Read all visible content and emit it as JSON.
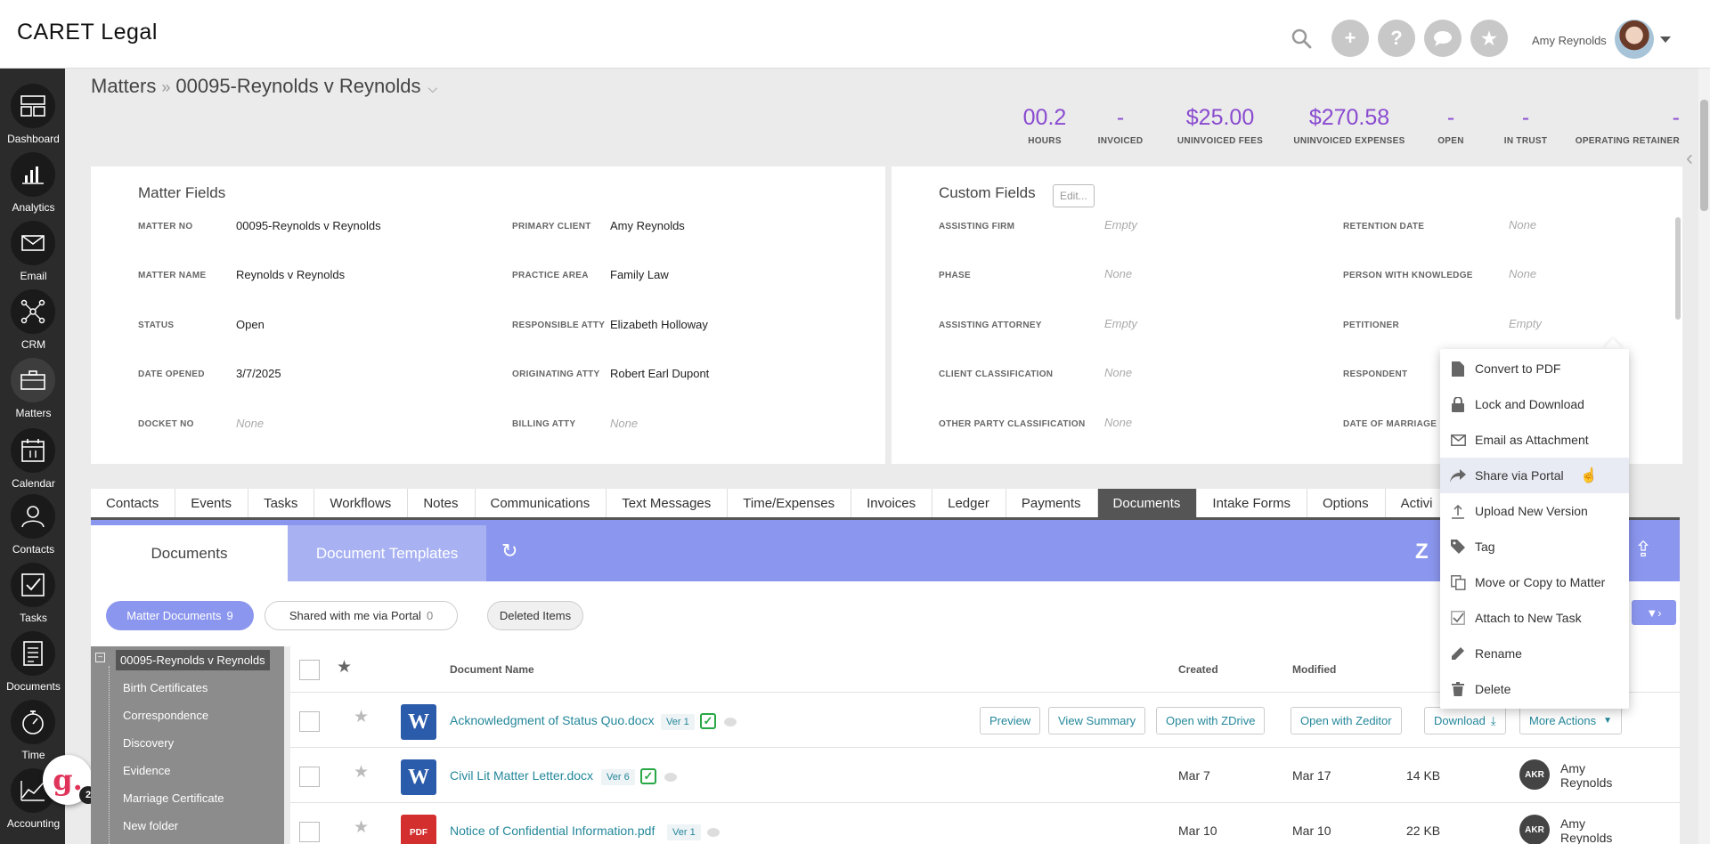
{
  "app": {
    "logo_text": "CARET Legal",
    "user_name": "Amy Reynolds"
  },
  "leftnav": [
    {
      "label": "Dashboard",
      "icon": "dashboard-icon"
    },
    {
      "label": "Analytics",
      "icon": "analytics-icon"
    },
    {
      "label": "Email",
      "icon": "email-icon"
    },
    {
      "label": "CRM",
      "icon": "crm-icon"
    },
    {
      "label": "Matters",
      "icon": "briefcase-icon"
    },
    {
      "label": "Calendar",
      "icon": "calendar-icon"
    },
    {
      "label": "Contacts",
      "icon": "contacts-icon"
    },
    {
      "label": "Tasks",
      "icon": "tasks-icon"
    },
    {
      "label": "Documents",
      "icon": "documents-icon"
    },
    {
      "label": "Time",
      "icon": "stopwatch-icon"
    },
    {
      "label": "Accounting",
      "icon": "accounting-icon"
    }
  ],
  "notification": {
    "letter": "g.",
    "count": "2"
  },
  "breadcrumb": {
    "root": "Matters",
    "separator": "»",
    "current": "00095-Reynolds v Reynolds"
  },
  "stats": [
    {
      "value": "00.2",
      "label": "HOURS"
    },
    {
      "value": "-",
      "label": "INVOICED"
    },
    {
      "value": "$25.00",
      "label": "UNINVOICED FEES"
    },
    {
      "value": "$270.58",
      "label": "UNINVOICED EXPENSES"
    },
    {
      "value": "-",
      "label": "OPEN"
    },
    {
      "value": "-",
      "label": "IN TRUST"
    },
    {
      "value": "-",
      "label": "OPERATING RETAINER"
    }
  ],
  "matter_fields": {
    "title": "Matter Fields",
    "fields": [
      {
        "label": "MATTER NO",
        "value": "00095-Reynolds v Reynolds"
      },
      {
        "label": "PRIMARY CLIENT",
        "value": "Amy Reynolds"
      },
      {
        "label": "MATTER NAME",
        "value": "Reynolds v Reynolds"
      },
      {
        "label": "PRACTICE AREA",
        "value": "Family Law"
      },
      {
        "label": "STATUS",
        "value": "Open"
      },
      {
        "label": "RESPONSIBLE ATTY",
        "value": "Elizabeth Holloway"
      },
      {
        "label": "DATE OPENED",
        "value": "3/7/2025"
      },
      {
        "label": "ORIGINATING ATTY",
        "value": "Robert Earl Dupont"
      },
      {
        "label": "DOCKET NO",
        "value": "None"
      },
      {
        "label": "BILLING ATTY",
        "value": "None"
      }
    ]
  },
  "custom_fields": {
    "title": "Custom Fields",
    "edit_label": "Edit...",
    "fields": [
      {
        "label": "ASSISTING FIRM",
        "value": "Empty"
      },
      {
        "label": "RETENTION DATE",
        "value": "None"
      },
      {
        "label": "PHASE",
        "value": "None"
      },
      {
        "label": "PERSON WITH KNOWLEDGE",
        "value": "None"
      },
      {
        "label": "ASSISTING ATTORNEY",
        "value": "Empty"
      },
      {
        "label": "PETITIONER",
        "value": "Empty"
      },
      {
        "label": "CLIENT CLASSIFICATION",
        "value": "None"
      },
      {
        "label": "RESPONDENT",
        "value": ""
      },
      {
        "label": "OTHER PARTY CLASSIFICATION",
        "value": "None"
      },
      {
        "label": "DATE OF MARRIAGE",
        "value": ""
      }
    ]
  },
  "tabs": [
    "Contacts",
    "Events",
    "Tasks",
    "Workflows",
    "Notes",
    "Communications",
    "Text Messages",
    "Time/Expenses",
    "Invoices",
    "Ledger",
    "Payments",
    "Documents",
    "Intake Forms",
    "Options",
    "Activi"
  ],
  "active_tab": "Documents",
  "documents": {
    "tab_documents": "Documents",
    "tab_templates": "Document Templates",
    "filters": [
      {
        "label": "Matter Documents",
        "count": "9"
      },
      {
        "label": "Shared with me via Portal",
        "count": "0"
      },
      {
        "label": "Deleted Items",
        "count": ""
      }
    ],
    "filter_button": "▼›"
  },
  "tree": {
    "root": "00095-Reynolds v Reynolds",
    "toggle": "−",
    "folders": [
      "Birth Certificates",
      "Correspondence",
      "Discovery",
      "Evidence",
      "Marriage Certificate",
      "New folder"
    ]
  },
  "table": {
    "headers": {
      "name": "Document Name",
      "created": "Created",
      "modified": "Modified"
    },
    "rows": [
      {
        "name": "Acknowledgment of Status Quo.docx",
        "ver": "Ver 1",
        "type": "word",
        "created": "",
        "modified": "",
        "size": ""
      },
      {
        "name": "Civil Lit Matter Letter.docx",
        "ver": "Ver 6",
        "type": "word",
        "created": "Mar 7",
        "modified": "Mar 17",
        "size": "14 KB",
        "owner_initials": "AKR",
        "owner": "Amy Reynolds"
      },
      {
        "name": "Notice of Confidential Information.pdf",
        "ver": "Ver 1",
        "type": "pdf",
        "created": "Mar 10",
        "modified": "Mar 10",
        "size": "22 KB",
        "owner_initials": "AKR",
        "owner": "Amy Reynolds"
      }
    ],
    "row_actions": [
      "Preview",
      "View Summary",
      "Open with ZDrive",
      "Open with Zeditor",
      "Download",
      "More Actions"
    ]
  },
  "context_menu": [
    {
      "label": "Convert to PDF",
      "icon": "file-icon"
    },
    {
      "label": "Lock and Download",
      "icon": "lock-icon"
    },
    {
      "label": "Email as Attachment",
      "icon": "envelope-icon"
    },
    {
      "label": "Share via Portal",
      "icon": "share-icon"
    },
    {
      "label": "Upload New Version",
      "icon": "upload-icon"
    },
    {
      "label": "Tag",
      "icon": "tag-icon"
    },
    {
      "label": "Move or Copy to Matter",
      "icon": "copy-icon"
    },
    {
      "label": "Attach to New Task",
      "icon": "task-check-icon"
    },
    {
      "label": "Rename",
      "icon": "pencil-icon"
    },
    {
      "label": "Delete",
      "icon": "trash-icon"
    }
  ],
  "colors": {
    "accent": "#8a4bd0",
    "documents_header": "#8b96ee",
    "link": "#23879a",
    "nav_bg": "#2b2b2b"
  }
}
